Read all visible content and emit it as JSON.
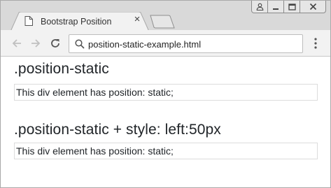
{
  "window": {
    "controls": [
      "user-icon",
      "minimize-icon",
      "maximize-icon",
      "close-icon"
    ]
  },
  "tab": {
    "title": "Bootstrap Position",
    "close_label": "×"
  },
  "toolbar": {
    "url": "position-static-example.html"
  },
  "content": {
    "heading1": ".position-static",
    "box1_text": "This div element has position: static;",
    "heading2": ".position-static + style: left:50px",
    "box2_text": "This div element has position: static;"
  },
  "colors": {
    "tabstrip": "#d9d9d9",
    "toolbar": "#f2f2f2",
    "text": "#212529",
    "box_border": "#dcdcdc"
  }
}
